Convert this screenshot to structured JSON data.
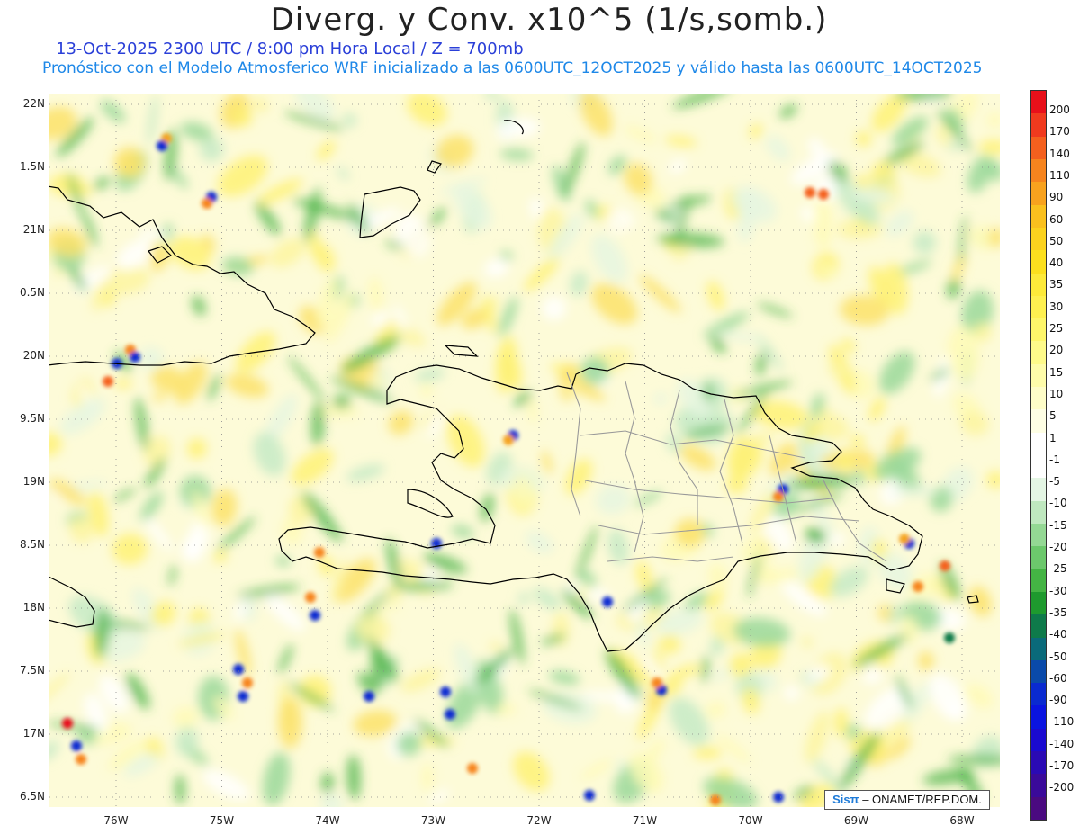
{
  "title": "Diverg. y Conv. x10^5 (1/s,somb.)",
  "subtitle_line1": "13-Oct-2025  2300 UTC / 8:00 pm Hora Local / Z = 700mb",
  "subtitle_line2": "Pronóstico con el Modelo Atmosferico WRF inicializado a las 0600UTC_12OCT2025 y válido hasta las  0600UTC_14OCT2025",
  "credit": {
    "logo": "Sisπ",
    "text": "– ONAMET/REP.DOM."
  },
  "lat_labels": [
    "22N",
    "1.5N",
    "21N",
    "0.5N",
    "20N",
    "9.5N",
    "19N",
    "8.5N",
    "18N",
    "7.5N",
    "17N",
    "6.5N"
  ],
  "lon_labels": [
    "76W",
    "75W",
    "74W",
    "73W",
    "72W",
    "71W",
    "70W",
    "69W",
    "68W"
  ],
  "colorbar": {
    "labels": [
      "200",
      "170",
      "140",
      "110",
      "90",
      "60",
      "50",
      "40",
      "35",
      "30",
      "25",
      "20",
      "15",
      "10",
      "5",
      "1",
      "-1",
      "-5",
      "-10",
      "-15",
      "-20",
      "-25",
      "-30",
      "-35",
      "-40",
      "-50",
      "-60",
      "-90",
      "-110",
      "-140",
      "-170",
      "-200"
    ],
    "colors": [
      "#e8101a",
      "#f03a1e",
      "#f4601e",
      "#f6841e",
      "#f8a21e",
      "#fac01e",
      "#fbd21e",
      "#fce01e",
      "#fdea3a",
      "#fef050",
      "#fef66a",
      "#fefa8a",
      "#fefcaa",
      "#fefdc8",
      "#fefee4",
      "#ffffff",
      "#ffffff",
      "#e4f6e4",
      "#bfe8bf",
      "#94d894",
      "#6cc86c",
      "#44b444",
      "#1e9a2e",
      "#0e7a4a",
      "#0a6a7a",
      "#0a4aaa",
      "#0a2ad0",
      "#0a14e0",
      "#1a0ad0",
      "#2a0ab4",
      "#3a0a9a",
      "#4a0a80"
    ]
  },
  "colors": {
    "title": "#222222",
    "subtitle1": "#2a3fd8",
    "subtitle2": "#1e88e8",
    "coast": "#000000",
    "provinces": "#999999"
  }
}
